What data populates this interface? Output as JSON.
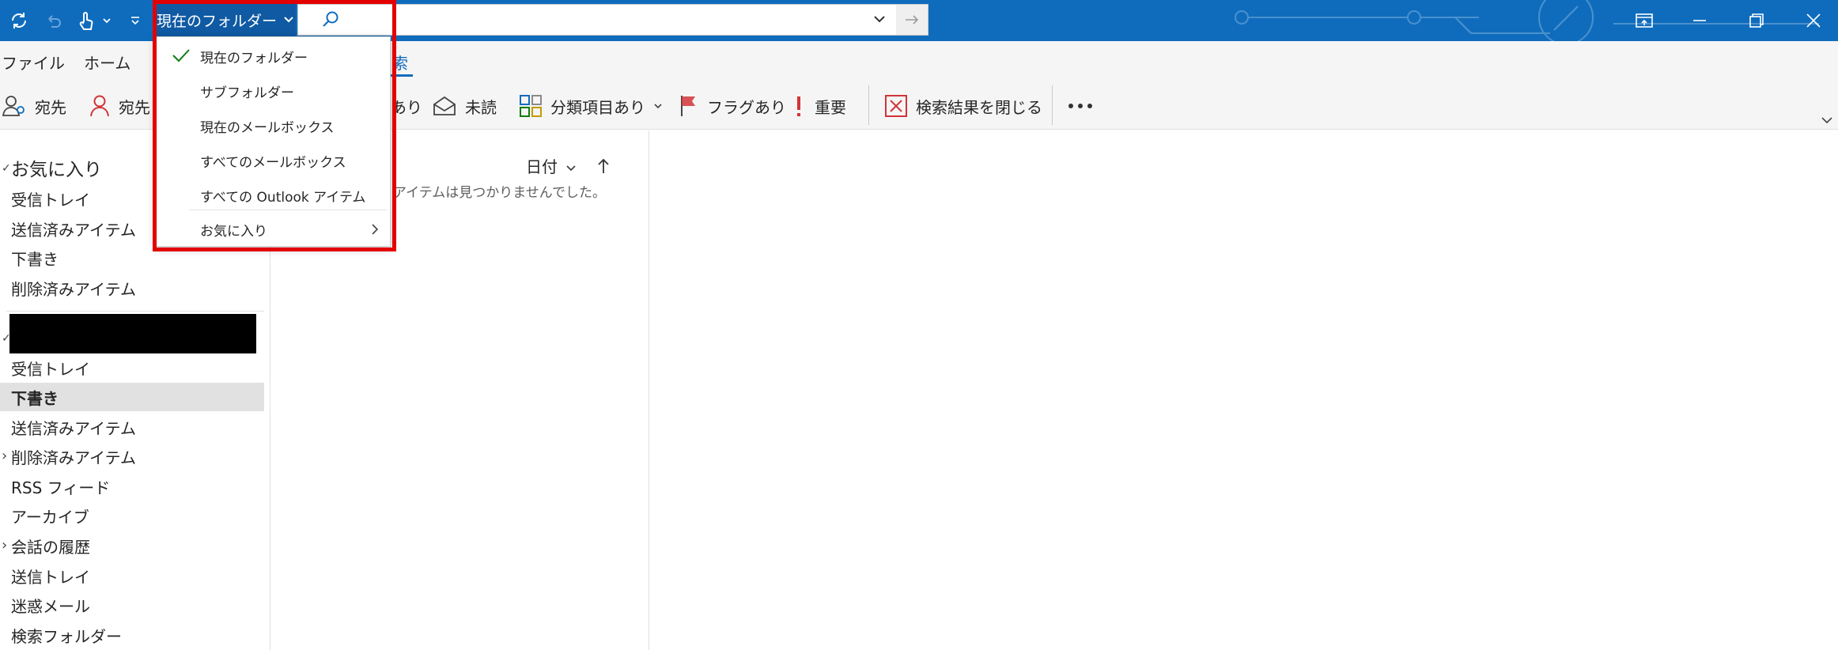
{
  "title_bar": {
    "search_scope_label": "現在のフォルダー",
    "search_input_value": "",
    "search_input_placeholder": ""
  },
  "menu_tabs": [
    {
      "label": "ファイル"
    },
    {
      "label": "ホーム"
    },
    {
      "label": "索",
      "active": true
    }
  ],
  "ribbon": {
    "to_label": "宛先",
    "cc_label": "宛先",
    "attach_partial": "あり",
    "unread_label": "未読",
    "categorized_label": "分類項目あり",
    "flagged_label": "フラグあり",
    "important_label": "重要",
    "close_search_label": "検索結果を閉じる"
  },
  "favorites": {
    "header": "お気に入り",
    "items": [
      "受信トレイ",
      "送信済みアイテム",
      "下書き",
      "削除済みアイテム"
    ]
  },
  "mailbox": {
    "items": [
      "受信トレイ",
      "下書き",
      "送信済みアイテム",
      "削除済みアイテム",
      "RSS フィード",
      "アーカイブ",
      "会話の履歴",
      "送信トレイ",
      "迷惑メール",
      "検索フォルダー"
    ],
    "selected_index": 1
  },
  "message_list": {
    "sort_label": "日付",
    "empty_text": "アイテムは見つかりませんでした。"
  },
  "scope_dropdown": {
    "items": [
      "現在のフォルダー",
      "サブフォルダー",
      "現在のメールボックス",
      "すべてのメールボックス",
      "すべての Outlook アイテム"
    ],
    "checked_index": 0,
    "favorites_label": "お気に入り"
  },
  "colors": {
    "accent": "#0f6cbd",
    "highlight_border": "#e30000",
    "check": "#107c10",
    "flag": "#d13438"
  }
}
